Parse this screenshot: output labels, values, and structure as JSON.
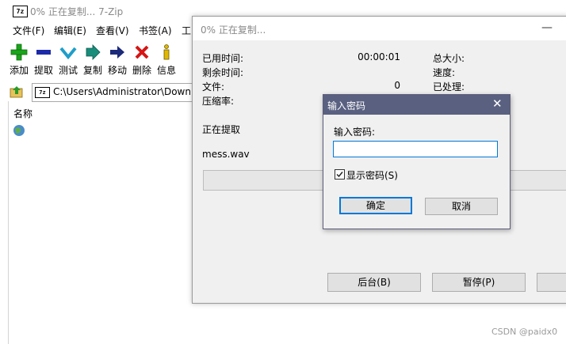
{
  "main": {
    "app_icon": "7z",
    "title": "0% 正在复制... 7-Zip",
    "menu": [
      "文件(F)",
      "编辑(E)",
      "查看(V)",
      "书签(A)",
      "工"
    ],
    "toolbar": [
      {
        "label": "添加",
        "icon": "add-icon",
        "color": "#1aa41a"
      },
      {
        "label": "提取",
        "icon": "extract-icon",
        "color": "#1c2aa8"
      },
      {
        "label": "测试",
        "icon": "test-icon",
        "color": "#1f9ec9"
      },
      {
        "label": "复制",
        "icon": "copy-icon",
        "color": "#1a8c7a"
      },
      {
        "label": "移动",
        "icon": "move-icon",
        "color": "#1c2a7a"
      },
      {
        "label": "删除",
        "icon": "delete-icon",
        "color": "#d61414"
      },
      {
        "label": "信息",
        "icon": "info-icon",
        "color": "#e0b800"
      }
    ],
    "address": "C:\\Users\\Administrator\\Downlo",
    "column_header": "名称"
  },
  "progress": {
    "title": "0% 正在复制...",
    "elapsed_label": "已用时间:",
    "elapsed_value": "00:00:01",
    "remaining_label": "剩余时间:",
    "files_label": "文件:",
    "files_value": "0",
    "ratio_label": "压缩率:",
    "total_size_label": "总大小:",
    "speed_label": "速度:",
    "processed_label": "已处理:",
    "status": "正在提取",
    "filename": "mess.wav",
    "progress_fraction": 0,
    "background_button": "后台(B)",
    "pause_button": "暂停(P)"
  },
  "password_dialog": {
    "title": "输入密码",
    "label": "输入密码:",
    "value": "",
    "show_password_label": "显示密码(S)",
    "show_password_checked": true,
    "ok": "确定",
    "cancel": "取消",
    "accent": "#0078d7",
    "titlebar_color": "#596080"
  },
  "watermark": "CSDN @paidx0"
}
